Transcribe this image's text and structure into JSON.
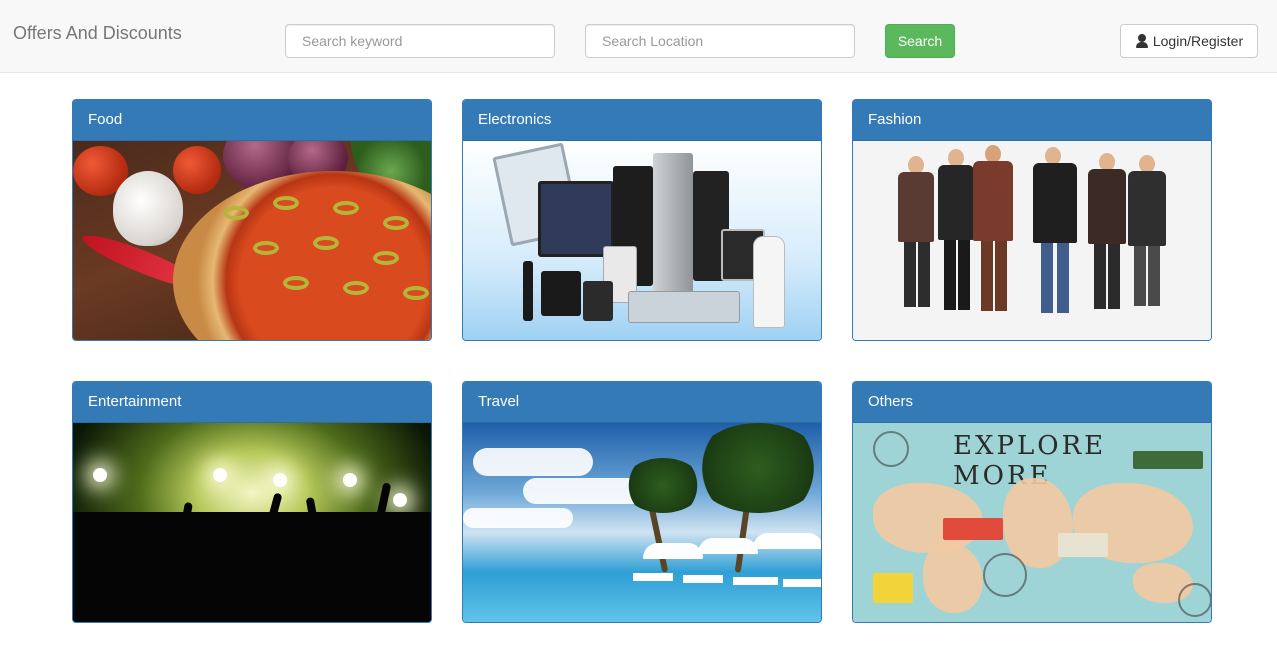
{
  "navbar": {
    "brand": "Offers And Discounts",
    "keyword_placeholder": "Search keyword",
    "location_placeholder": "Search Location",
    "search_label": "Search",
    "login_label": "Login/Register"
  },
  "categories": [
    {
      "title": "Food"
    },
    {
      "title": "Electronics"
    },
    {
      "title": "Fashion"
    },
    {
      "title": "Entertainment"
    },
    {
      "title": "Travel"
    },
    {
      "title": "Others"
    }
  ],
  "others_image": {
    "headline": "EXPLORE MORE"
  },
  "colors": {
    "panel_primary": "#337ab7",
    "search_button": "#5cb85c",
    "navbar_bg": "#f8f8f8"
  }
}
